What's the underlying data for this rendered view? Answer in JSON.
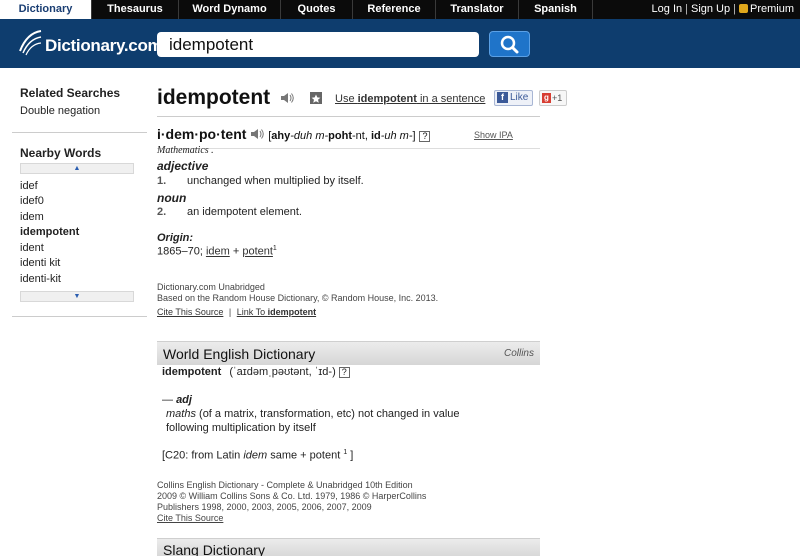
{
  "nav": {
    "tabs": [
      "Dictionary",
      "Thesaurus",
      "Word Dynamo",
      "Quotes",
      "Reference",
      "Translator",
      "Spanish"
    ],
    "login": "Log In",
    "signup": "Sign Up",
    "premium": "Premium"
  },
  "header": {
    "logo": "Dictionary.com",
    "search_value": "idempotent"
  },
  "sidebar": {
    "related_title": "Related Searches",
    "related": [
      "Double negation"
    ],
    "nearby_title": "Nearby Words",
    "nearby": [
      "idef",
      "idef0",
      "idem",
      "idempotent",
      "ident",
      "identi kit",
      "identi-kit"
    ],
    "current": "idempotent"
  },
  "entry": {
    "headword": "idempotent",
    "use_in_sentence_pre": "Use ",
    "use_in_sentence_word": "idempotent",
    "use_in_sentence_post": " in a sentence",
    "like_label": "Like",
    "plus_label": "+1",
    "syllables": "i·dem·po·tent",
    "pron_open": "[",
    "pron_a": "ahy",
    "pron_b": "-duh m-",
    "pron_c": "poht",
    "pron_d": "-nt, ",
    "pron_e": "id",
    "pron_f": "-uh m-",
    "pron_close": "]",
    "q": "?",
    "show_ipa": "Show IPA",
    "field": "Mathematics .",
    "pos1": "adjective",
    "num1": "1.",
    "def1": "unchanged when multiplied by itself.",
    "pos2": "noun",
    "num2": "2.",
    "def2": "an idempotent element.",
    "origin_label": "Origin:",
    "origin_pre": "1865–70; ",
    "origin_w1": "idem",
    "origin_plus": " + ",
    "origin_w2": "potent",
    "origin_sup": "1",
    "source1": "Dictionary.com Unabridged",
    "source2": "Based on the Random House Dictionary, © Random House, Inc. 2013.",
    "cite": "Cite This Source",
    "divider": "|",
    "link_to": "Link To ",
    "link_word": "idempotent"
  },
  "world": {
    "title": "World English Dictionary",
    "publisher": "Collins",
    "headword": "idempotent",
    "pron": "(ˈaɪdəmˌpəʊtənt, ˈɪd-)",
    "q": "?",
    "pos_dash": "— ",
    "pos": "adj",
    "field": "maths",
    "def1": "(of a matrix, transformation, etc) not changed in value",
    "def2": "following multiplication by itself",
    "etym_pre": "[C20: from Latin ",
    "etym_word": "idem",
    "etym_mid": "  same + potent ",
    "etym_sup": "1",
    "etym_post": " ]",
    "src1": "Collins English Dictionary - Complete & Unabridged 10th Edition",
    "src2": "2009 © William Collins Sons & Co. Ltd. 1979, 1986 © HarperCollins",
    "src3": "Publishers 1998, 2000, 2003, 2005, 2006, 2007, 2009",
    "cite": "Cite This Source"
  },
  "slang": {
    "title": "Slang Dictionary"
  },
  "colors": {
    "nav_bg": "#0b0b0b",
    "header_bg": "#0e3d6e",
    "search_button": "#1f74c9",
    "pos_color": "#111111",
    "number_color": "#555555"
  },
  "icons": [
    "speaker-icon",
    "star-icon",
    "facebook-icon",
    "google-plus-icon",
    "search-icon",
    "lock-icon",
    "scroll-up-icon",
    "scroll-down-icon"
  ]
}
